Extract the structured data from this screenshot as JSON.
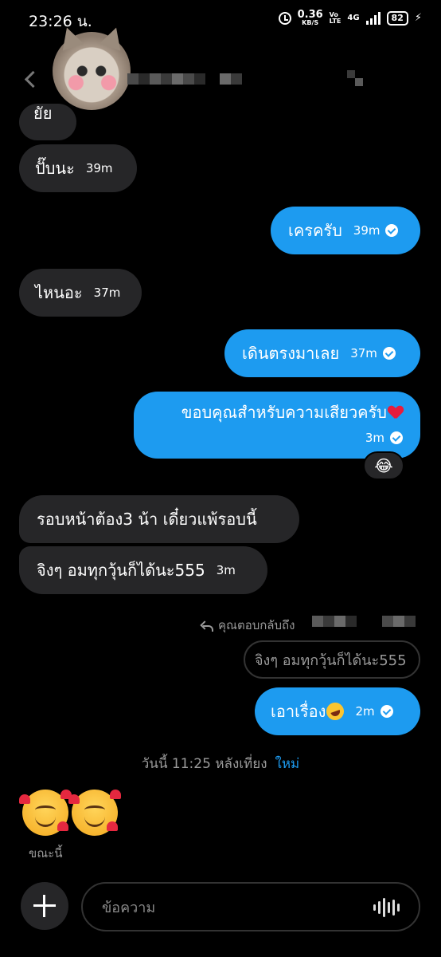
{
  "status_bar": {
    "time": "23:26 น.",
    "speed_value": "0.36",
    "speed_unit": "KB/S",
    "volte_top": "Vo",
    "volte_bottom": "LTE",
    "network": "4G",
    "battery": "82"
  },
  "messages": [
    {
      "id": "partial",
      "side": "in",
      "text": "ยัย",
      "time": ""
    },
    {
      "id": "b1",
      "side": "in",
      "text": "ปั๊บนะ",
      "time": "39m"
    },
    {
      "id": "b2",
      "side": "out",
      "text": "เครครับ",
      "time": "39m"
    },
    {
      "id": "b3",
      "side": "in",
      "text": "ไหนอะ",
      "time": "37m"
    },
    {
      "id": "b4",
      "side": "out",
      "text": "เดินตรงมาเลย",
      "time": "37m"
    },
    {
      "id": "b5",
      "side": "out",
      "text": "ขอบคุณสำหรับความเสียวครับ",
      "time": "3m",
      "reaction": "😂"
    },
    {
      "id": "b6",
      "side": "in",
      "text": "รอบหน้าต้อง3 น้า  เดี๋ยวแพ้รอบนี้",
      "time": ""
    },
    {
      "id": "b7",
      "side": "in",
      "text": "จิงๆ อมทุกวุ้นก็ได้นะ555",
      "time": "3m"
    },
    {
      "id": "b8",
      "side": "out",
      "text": "เอาเรื่อง",
      "time": "2m"
    }
  ],
  "reply": {
    "label": "คุณตอบกลับถึง",
    "quoted_text": "จิงๆ อมทุกวุ้นก็ได้นะ555"
  },
  "divider": {
    "text": "วันนี้ 11:25 หลังเที่ยง",
    "new_label": "ใหม่"
  },
  "seen_label": "ขณะนี้",
  "composer": {
    "placeholder": "ข้อความ"
  },
  "colors": {
    "outgoing_bubble": "#1d9bf0",
    "incoming_bubble": "#262628",
    "background": "#000000"
  }
}
